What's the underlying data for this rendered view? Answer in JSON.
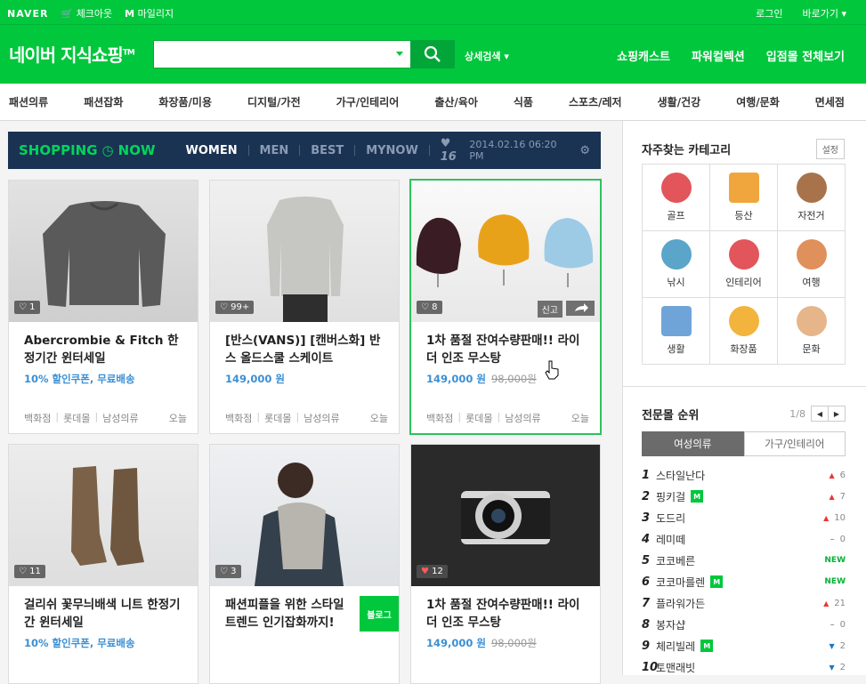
{
  "topbar": {
    "brand": "NAVER",
    "checkout": "체크아웃",
    "mileage": "마일리지",
    "login": "로그인",
    "shortcut": "바로가기"
  },
  "header": {
    "logo": "네이버 지식쇼핑",
    "logo_tm": "TM",
    "search_placeholder": "",
    "advanced": "상세검색",
    "links": [
      "쇼핑캐스트",
      "파워컬렉션",
      "입점몰 전체보기"
    ]
  },
  "categories": [
    "패션의류",
    "패션잡화",
    "화장품/미용",
    "디지털/가전",
    "가구/인테리어",
    "출산/육아",
    "식품",
    "스포츠/레저",
    "생활/건강",
    "여행/문화",
    "면세점"
  ],
  "now": {
    "title": "SHOPPING",
    "title2": "NOW",
    "tabs": [
      "WOMEN",
      "MEN",
      "BEST",
      "MYNOW"
    ],
    "likes": "16",
    "date": "2014.02.16 06:20 PM"
  },
  "cards": [
    {
      "likes": "1",
      "title": "Abercrombie & Fitch 한정기간 윈터세일",
      "sub": "10% 할인쿠폰, 무료배송",
      "old": "",
      "meta": [
        "백화점",
        "롯데몰",
        "남성의류"
      ],
      "day": "오늘"
    },
    {
      "likes": "99+",
      "title": "[반스(VANS)] [캔버스화] 반스 올드스쿨 스케이트",
      "sub": "149,000 원",
      "old": "",
      "meta": [
        "백화점",
        "롯데몰",
        "남성의류"
      ],
      "day": "오늘"
    },
    {
      "likes": "8",
      "title": "1차 품절 잔여수량판매!! 라이더 인조 무스탕",
      "sub": "149,000 원",
      "old": "98,000원",
      "meta": [
        "백화점",
        "롯데몰",
        "남성의류"
      ],
      "day": "오늘",
      "report": "신고"
    },
    {
      "likes": "11",
      "title": "걸리쉬 꽃무늬배색 니트 한정기간 윈터세일",
      "sub": "10% 할인쿠폰, 무료배송",
      "old": "",
      "meta": [],
      "day": ""
    },
    {
      "likes": "3",
      "title": "패션피플을 위한 스타일 트렌드 인기잡화까지!",
      "sub": "",
      "old": "",
      "meta": [],
      "day": "",
      "blog": "블로그"
    },
    {
      "likes": "12",
      "title": "1차 품절 잔여수량판매!! 라이더 인조 무스탕",
      "sub": "149,000 원",
      "old": "98,000원",
      "meta": [],
      "day": ""
    }
  ],
  "side": {
    "fav_title": "자주찾는 카테고리",
    "settings": "설정",
    "fav": [
      {
        "label": "골프",
        "color": "#e2555a"
      },
      {
        "label": "등산",
        "color": "#f0a63c"
      },
      {
        "label": "자전거",
        "color": "#a8734a"
      },
      {
        "label": "낚시",
        "color": "#5aa5c9"
      },
      {
        "label": "인테리어",
        "color": "#e2555a"
      },
      {
        "label": "여행",
        "color": "#e0905a"
      },
      {
        "label": "생활",
        "color": "#6fa4d8"
      },
      {
        "label": "화장품",
        "color": "#f2b43c"
      },
      {
        "label": "문화",
        "color": "#e6b58a"
      }
    ],
    "rank_title": "전문몰 순위",
    "page": "1/8",
    "tabs": [
      "여성의류",
      "가구/인테리어"
    ],
    "ranks": [
      {
        "n": "1",
        "name": "스타일난다",
        "m": false,
        "dir": "up",
        "v": "6"
      },
      {
        "n": "2",
        "name": "핑키걸",
        "m": true,
        "dir": "up",
        "v": "7"
      },
      {
        "n": "3",
        "name": "도드리",
        "m": false,
        "dir": "up",
        "v": "10"
      },
      {
        "n": "4",
        "name": "레미떼",
        "m": false,
        "dir": "eq",
        "v": "0"
      },
      {
        "n": "5",
        "name": "코코베른",
        "m": false,
        "dir": "new",
        "v": "NEW"
      },
      {
        "n": "6",
        "name": "코코마를렌",
        "m": true,
        "dir": "new",
        "v": "NEW"
      },
      {
        "n": "7",
        "name": "플라워가든",
        "m": false,
        "dir": "up",
        "v": "21"
      },
      {
        "n": "8",
        "name": "봉자샵",
        "m": false,
        "dir": "eq",
        "v": "0"
      },
      {
        "n": "9",
        "name": "체리빌레",
        "m": true,
        "dir": "dn",
        "v": "2"
      },
      {
        "n": "10",
        "name": "토맨래빗",
        "m": false,
        "dir": "dn",
        "v": "2"
      }
    ]
  }
}
